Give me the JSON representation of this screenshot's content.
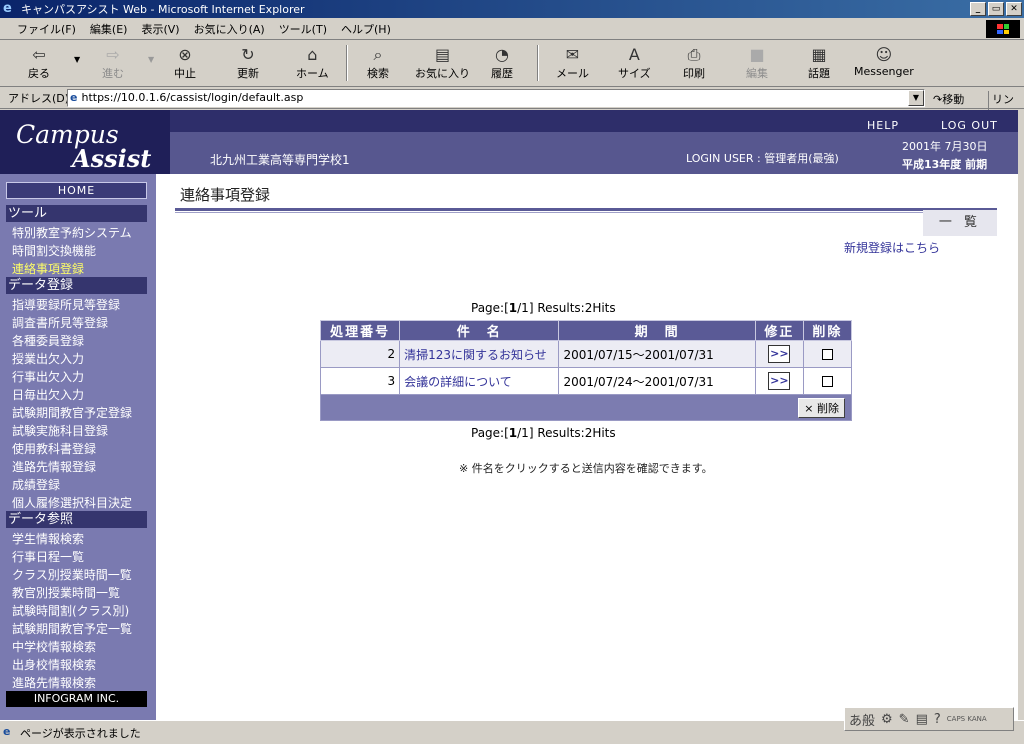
{
  "window": {
    "title": "キャンパスアシスト  Web - Microsoft Internet Explorer",
    "buttons": {
      "minimize": "_",
      "maximize": "▭",
      "close": "✕"
    }
  },
  "menubar": [
    "ファイル(F)",
    "編集(E)",
    "表示(V)",
    "お気に入り(A)",
    "ツール(T)",
    "ヘルプ(H)"
  ],
  "toolbar": {
    "back": "戻る",
    "forward": "進む",
    "stop": "中止",
    "refresh": "更新",
    "home": "ホーム",
    "search": "検索",
    "favorites": "お気に入り",
    "history": "履歴",
    "mail": "メール",
    "size": "サイズ",
    "print": "印刷",
    "edit": "編集",
    "discuss": "話題",
    "messenger": "Messenger"
  },
  "address": {
    "label": "アドレス(D)",
    "url": "https://10.0.1.6/cassist/login/default.asp",
    "go": "移動",
    "links": "リンク"
  },
  "header": {
    "logo_line1": "Campus",
    "logo_line2": "Assist",
    "school": "北九州工業高等専門学校1",
    "login_user": "LOGIN USER : 管理者用(最強)",
    "help": "HELP",
    "logout": "LOG OUT",
    "date": "2001年  7月30日",
    "term": "平成13年度  前期"
  },
  "sidebar": {
    "home": "HOME",
    "sections": [
      {
        "title": "ツール",
        "items": [
          "特別教室予約システム",
          "時間割交換機能",
          "連絡事項登録"
        ]
      },
      {
        "title": "データ登録",
        "items": [
          "指導要録所見等登録",
          "調査書所見等登録",
          "各種委員登録",
          "授業出欠入力",
          "行事出欠入力",
          "日毎出欠入力",
          "試験期間教官予定登録",
          "試験実施科目登録",
          "使用教科書登録",
          "進路先情報登録",
          "成績登録",
          "個人履修選択科目決定"
        ]
      },
      {
        "title": "データ参照",
        "items": [
          "学生情報検索",
          "行事日程一覧",
          "クラス別授業時間一覧",
          "教官別授業時間一覧",
          "試験時間割(クラス別)",
          "試験期間教官予定一覧",
          "中学校情報検索",
          "出身校情報検索",
          "進路先情報検索"
        ]
      }
    ],
    "footer": "INFOGRAM INC."
  },
  "main": {
    "title": "連絡事項登録",
    "list_button": "一 覧",
    "new_link": "新規登録はこちら",
    "pager": {
      "prefix": "Page:[",
      "current": "1",
      "suffix": "/1] Results:2Hits"
    },
    "table": {
      "headers": [
        "処理番号",
        "件　名",
        "期　間",
        "修正",
        "削除"
      ],
      "rows": [
        {
          "no": "2",
          "subject": "清掃123に関するお知らせ",
          "period": "2001/07/15～2001/07/31",
          "edit": ">>"
        },
        {
          "no": "3",
          "subject": "会議の詳細について",
          "period": "2001/07/24～2001/07/31",
          "edit": ">>"
        }
      ],
      "delete_button": "× 削除"
    },
    "note": "※ 件名をクリックすると送信内容を確認できます。"
  },
  "statusbar": {
    "text": "ページが表示されました"
  },
  "ime": {
    "mode": "あ般",
    "caps": "CAPS\nKANA"
  }
}
